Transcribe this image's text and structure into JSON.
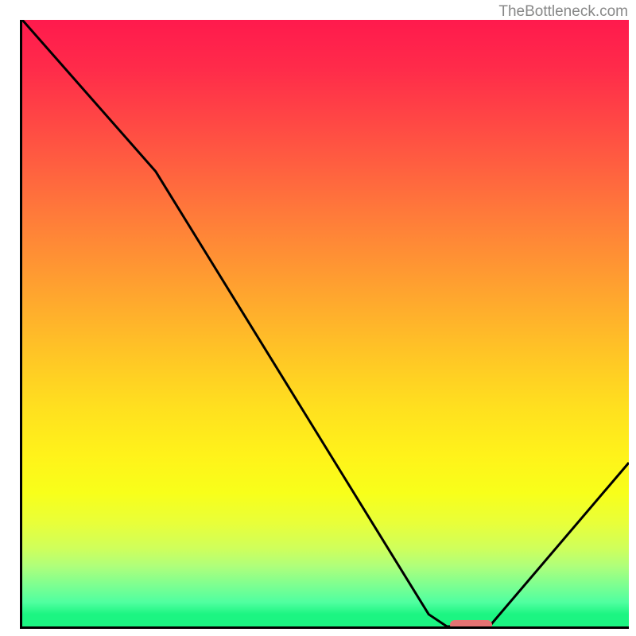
{
  "watermark": "TheBottleneck.com",
  "chart_data": {
    "type": "line",
    "title": "",
    "xlabel": "",
    "ylabel": "",
    "xlim": [
      0,
      100
    ],
    "ylim": [
      0,
      100
    ],
    "series": [
      {
        "name": "curve",
        "x": [
          0,
          22,
          67,
          70,
          77,
          100
        ],
        "y": [
          100,
          75,
          2,
          0,
          0,
          27
        ],
        "stroke": "#000000"
      }
    ],
    "marker": {
      "x_start": 70.5,
      "x_end": 77.5,
      "y": 0,
      "color": "#e57373"
    },
    "background_gradient": {
      "direction": "vertical",
      "stops": [
        {
          "pos": 0,
          "color": "#ff1a4d"
        },
        {
          "pos": 50,
          "color": "#ffae2c"
        },
        {
          "pos": 78,
          "color": "#f8ff1a"
        },
        {
          "pos": 100,
          "color": "#1cf582"
        }
      ]
    }
  }
}
